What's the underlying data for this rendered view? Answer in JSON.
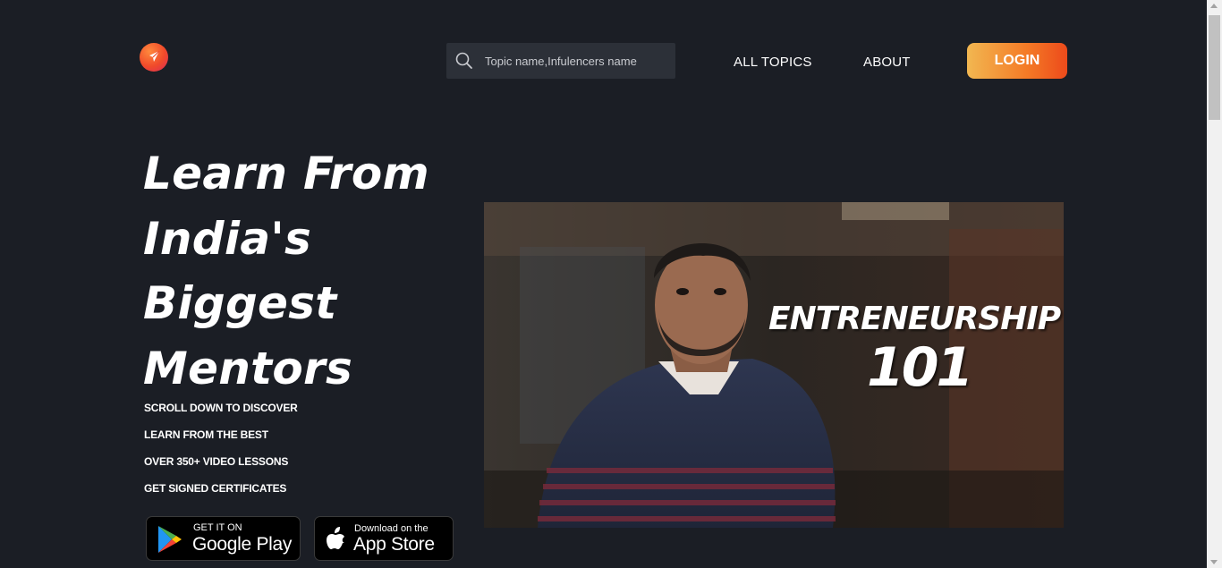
{
  "header": {
    "logo_icon": "rocket-logo-icon",
    "search": {
      "placeholder": "Topic name,Infulencers name",
      "icon": "search-icon"
    },
    "nav": {
      "all_topics": "ALL TOPICS",
      "about": "ABOUT"
    },
    "login_label": "LOGIN",
    "colors": {
      "accent_start": "#f2b751",
      "accent_end": "#ec4a1b",
      "background": "#1b1e25"
    }
  },
  "hero": {
    "title_lines": [
      "Learn From",
      "India's",
      "Biggest",
      "Mentors"
    ],
    "features": [
      "SCROLL DOWN TO DISCOVER",
      "LEARN FROM THE BEST",
      "OVER 350+ VIDEO LESSONS",
      "GET SIGNED CERTIFICATES"
    ]
  },
  "stores": {
    "google": {
      "small": "GET IT ON",
      "big": "Google Play",
      "icon": "google-play-icon"
    },
    "apple": {
      "small": "Download on the",
      "big": "App Store",
      "icon": "apple-icon"
    }
  },
  "video": {
    "overlay_line1": "ENTRENEURSHIP",
    "overlay_line2": "101"
  }
}
